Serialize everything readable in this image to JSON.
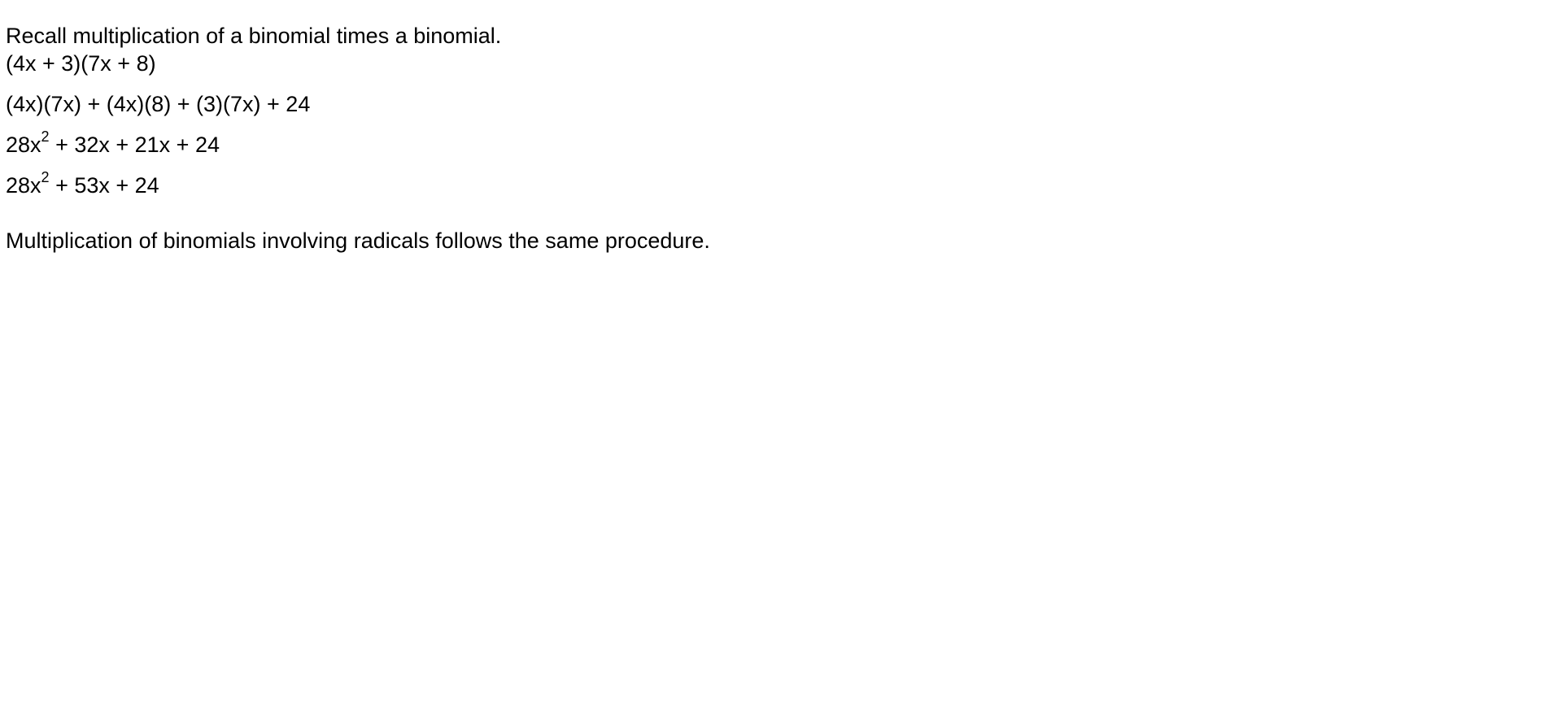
{
  "content": {
    "intro": "Recall multiplication of a binomial times a binomial.",
    "steps": {
      "s1": "(4x + 3)(7x + 8)",
      "s2": "(4x)(7x) + (4x)(8) + (3)(7x) + 24",
      "s3": {
        "base": "28x",
        "exp": "2",
        "rest": " + 32x + 21x + 24"
      },
      "s4": {
        "base": "28x",
        "exp": "2",
        "rest": " + 53x + 24"
      }
    },
    "conclusion": "Multiplication of binomials involving radicals follows the same procedure."
  }
}
